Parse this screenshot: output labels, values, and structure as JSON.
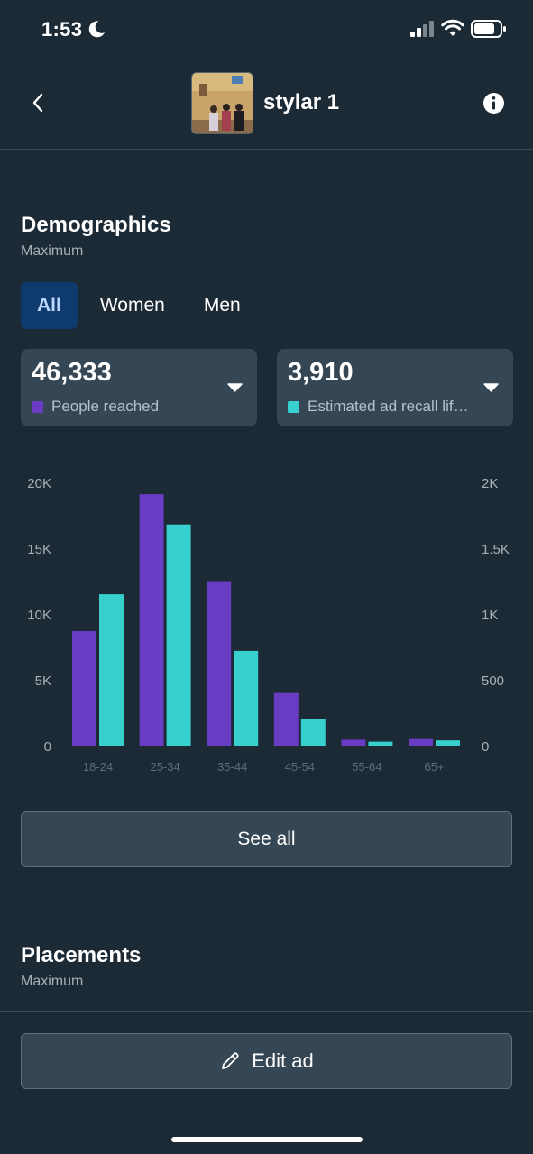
{
  "status_bar": {
    "time": "1:53"
  },
  "header": {
    "ad_name": "stylar 1"
  },
  "demographics": {
    "title": "Demographics",
    "subtitle": "Maximum",
    "tabs": [
      {
        "label": "All",
        "active": true
      },
      {
        "label": "Women",
        "active": false
      },
      {
        "label": "Men",
        "active": false
      }
    ],
    "metrics": [
      {
        "value": "46,333",
        "label": "People reached",
        "color": "#6a3cc4"
      },
      {
        "value": "3,910",
        "label": "Estimated ad recall lif…",
        "color": "#38cfcf"
      }
    ],
    "see_all_label": "See all"
  },
  "chart_data": {
    "type": "bar",
    "categories": [
      "18-24",
      "25-34",
      "35-44",
      "45-54",
      "55-64",
      "65+"
    ],
    "series": [
      {
        "name": "People reached",
        "axis": "left",
        "color": "#6a3cc4",
        "values": [
          8700,
          19100,
          12500,
          4000,
          450,
          500
        ]
      },
      {
        "name": "Estimated ad recall lift",
        "axis": "right",
        "color": "#38cfcf",
        "values": [
          1150,
          1680,
          720,
          200,
          30,
          40
        ]
      }
    ],
    "left_axis": {
      "ticks": [
        "0",
        "5K",
        "10K",
        "15K",
        "20K"
      ],
      "ylim": [
        0,
        20000
      ]
    },
    "right_axis": {
      "ticks": [
        "0",
        "500",
        "1K",
        "1.5K",
        "2K"
      ],
      "ylim": [
        0,
        2000
      ]
    },
    "grid": false,
    "legend": "none"
  },
  "placements": {
    "title": "Placements",
    "subtitle": "Maximum"
  },
  "footer": {
    "edit_label": "Edit ad"
  },
  "colors": {
    "background": "#1c2a35",
    "card": "#354754",
    "accent_tab": "#0f3a6e"
  }
}
